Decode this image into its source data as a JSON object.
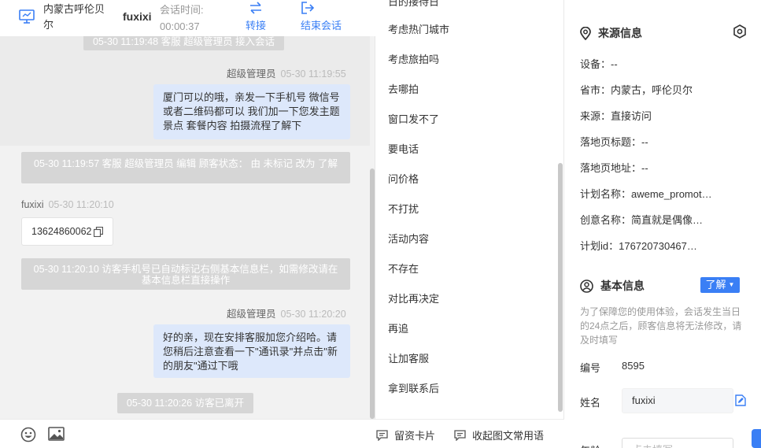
{
  "header": {
    "location": "内蒙古呼伦贝尔",
    "visitor": "fuxixi",
    "time_label": "会话时间:",
    "time_value": "00:00:37",
    "transfer_label": "转接",
    "end_label": "结束会话"
  },
  "messages": {
    "note_join": "05-30 11:19:48 客服 超级管理员 接入会话",
    "agent_name_1": "超级管理员",
    "agent_ts_1": "05-30 11:19:55",
    "agent_text_1": "厦门可以的哦，亲发一下手机号 微信号或者二维码都可以 我们加一下您发主题景点 套餐内容 拍摄流程了解下",
    "note_edit": "05-30 11:19:57 客服 超级管理员 编辑 顾客状态： 由 未标记 改为 了解",
    "visitor_name": "fuxixi",
    "visitor_ts": "05-30 11:20:10",
    "visitor_phone": "13624860062",
    "note_phone": "05-30 11:20:10 访客手机号已自动标记右侧基本信息栏，如需修改请在基本信息栏直接操作",
    "agent_name_2": "超级管理员",
    "agent_ts_2": "05-30 11:20:20",
    "agent_text_2": "好的亲，现在安排客服加您介绍哈。请您稍后注意查看一下\"通讯录\"并点击\"新的朋友\"通过下哦",
    "note_left": "05-30 11:20:26 访客已离开"
  },
  "quick_replies": {
    "items": [
      "日的接待日",
      "考虑热门城市",
      "考虑旅拍吗",
      "去哪拍",
      "窗口发不了",
      "要电话",
      "问价格",
      "不打扰",
      "活动内容",
      "不存在",
      "对比再决定",
      "再追",
      "让加客服",
      "拿到联系后"
    ],
    "card_label": "留资卡片",
    "collapse_label": "收起图文常用语"
  },
  "source_info": {
    "title": "来源信息",
    "device": "设备：--",
    "province": "省市：内蒙古，呼伦贝尔",
    "source": "来源：直接访问",
    "landing_title": "落地页标题：--",
    "landing_url": "落地页地址：--",
    "plan_name": "计划名称：aweme_promot…",
    "creative_name": "创意名称：简直就是偶像…",
    "plan_id": "计划id：176720730467…"
  },
  "basic_info": {
    "title": "基本信息",
    "status_button": "了解",
    "hint": "为了保障您的使用体验，会话发生当日的24点之后，顾客信息将无法修改，请及时填写",
    "id_label": "编号",
    "id_value": "8595",
    "name_label": "姓名",
    "name_value": "fuxixi",
    "age_label": "年龄",
    "age_placeholder": "点击填写"
  },
  "colors": {
    "accent": "#3a7ff5",
    "bubble": "#dde8fb",
    "system_note": "#d6d6d6"
  }
}
